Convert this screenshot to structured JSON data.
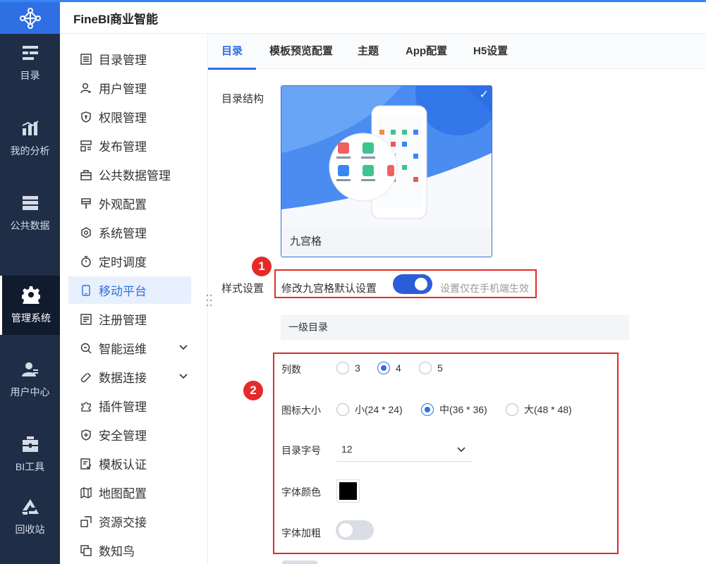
{
  "app": {
    "title": "FineBI商业智能"
  },
  "rail": [
    {
      "label": "目录",
      "icon": "catalog-icon"
    },
    {
      "label": "我的分析",
      "icon": "analysis-icon"
    },
    {
      "label": "公共数据",
      "icon": "database-icon"
    },
    {
      "label": "管理系统",
      "icon": "gear-icon",
      "active": true
    },
    {
      "label": "用户中心",
      "icon": "user-icon"
    },
    {
      "label": "BI工具",
      "icon": "toolbox-icon"
    },
    {
      "label": "回收站",
      "icon": "recycle-icon"
    }
  ],
  "subnav": [
    {
      "label": "目录管理",
      "icon": "list-icon"
    },
    {
      "label": "用户管理",
      "icon": "user-outline-icon"
    },
    {
      "label": "权限管理",
      "icon": "shield-lock-icon"
    },
    {
      "label": "发布管理",
      "icon": "publish-icon"
    },
    {
      "label": "公共数据管理",
      "icon": "briefcase-icon"
    },
    {
      "label": "外观配置",
      "icon": "brush-icon"
    },
    {
      "label": "系统管理",
      "icon": "settings-icon"
    },
    {
      "label": "定时调度",
      "icon": "timer-icon"
    },
    {
      "label": "移动平台",
      "icon": "mobile-icon",
      "active": true
    },
    {
      "label": "注册管理",
      "icon": "register-icon"
    },
    {
      "label": "智能运维",
      "icon": "ops-icon",
      "expandable": true
    },
    {
      "label": "数据连接",
      "icon": "link-icon",
      "expandable": true
    },
    {
      "label": "插件管理",
      "icon": "puzzle-icon"
    },
    {
      "label": "安全管理",
      "icon": "security-icon"
    },
    {
      "label": "模板认证",
      "icon": "certificate-icon"
    },
    {
      "label": "地图配置",
      "icon": "map-icon"
    },
    {
      "label": "资源交接",
      "icon": "transfer-icon"
    },
    {
      "label": "数知鸟",
      "icon": "copy-icon"
    }
  ],
  "tabs": [
    "目录",
    "模板预览配置",
    "主题",
    "App配置",
    "H5设置"
  ],
  "catalog": {
    "label": "目录结构",
    "card_label": "九宫格"
  },
  "style": {
    "label": "样式设置",
    "toggle_label": "修改九宫格默认设置",
    "toggle_on": true,
    "hint": "设置仅在手机端生效",
    "section_title": "一级目录",
    "columns": {
      "label": "列数",
      "options": [
        "3",
        "4",
        "5"
      ],
      "selected": "4"
    },
    "icon_size": {
      "label": "图标大小",
      "options": [
        "小(24 * 24)",
        "中(36 * 36)",
        "大(48 * 48)"
      ],
      "selected": "中(36 * 36)"
    },
    "font_size": {
      "label": "目录字号",
      "value": "12"
    },
    "font_color": {
      "label": "字体颜色",
      "value": "#000000"
    },
    "font_bold": {
      "label": "字体加粗",
      "on": false
    }
  },
  "badges": [
    "1",
    "2"
  ]
}
